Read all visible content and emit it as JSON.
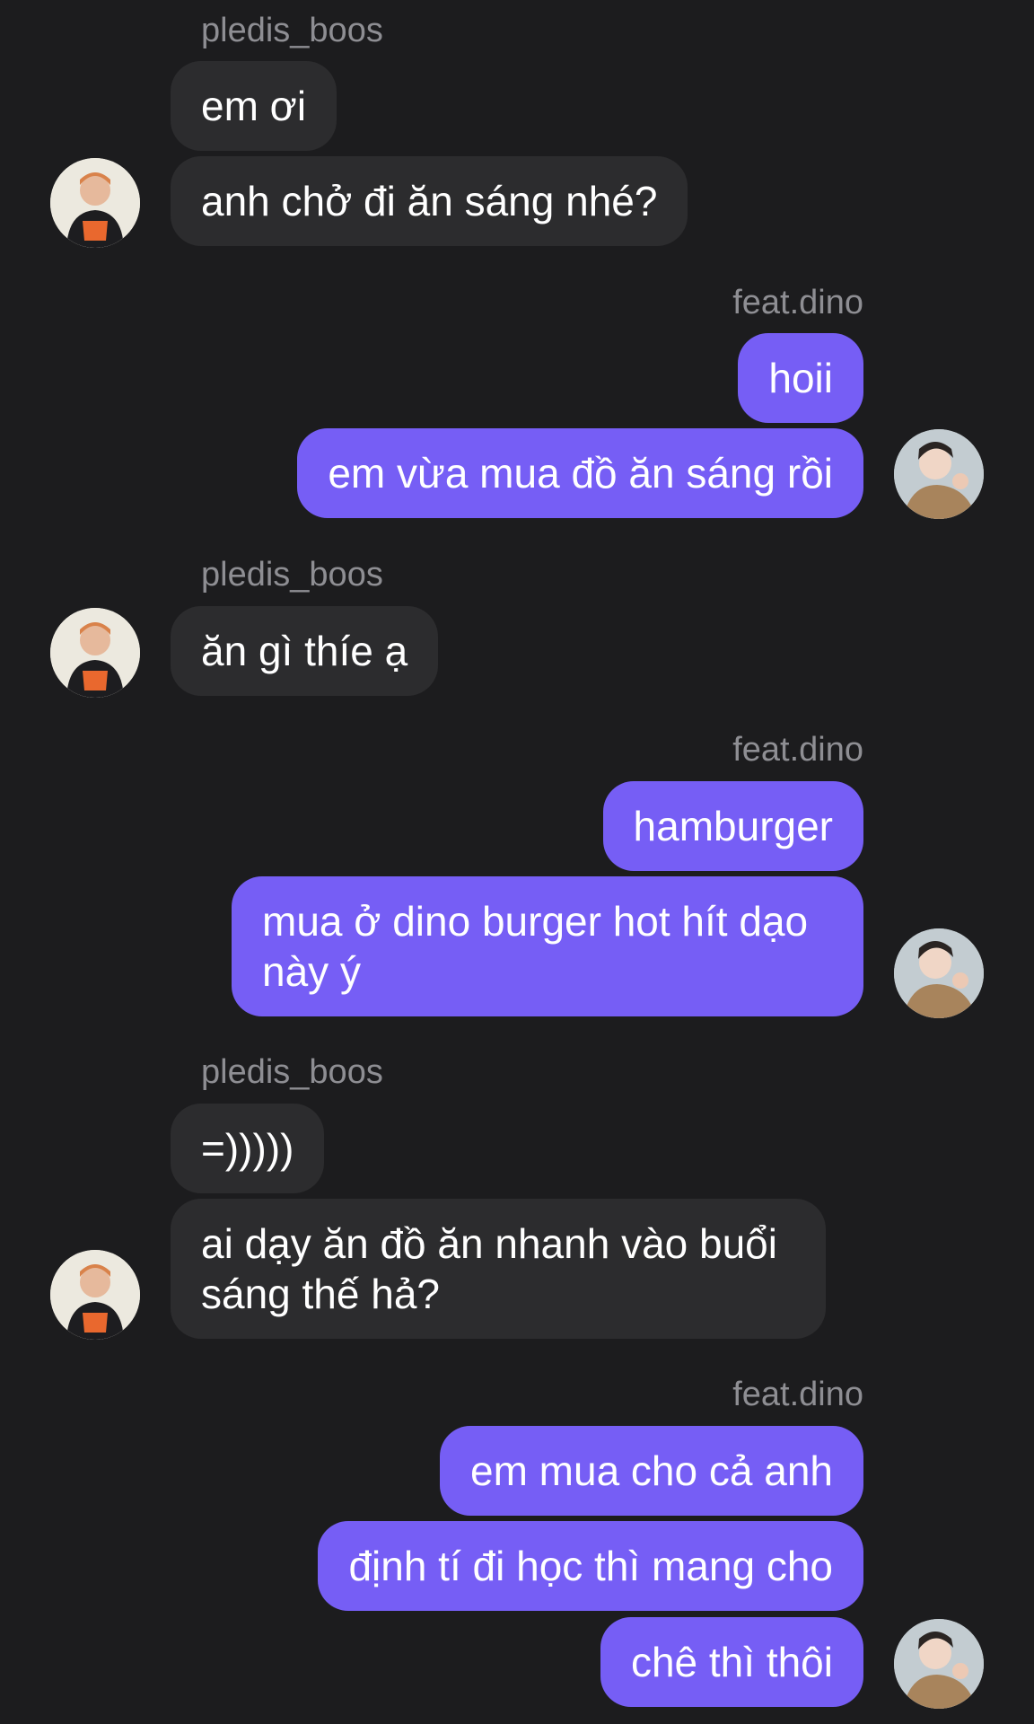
{
  "users": {
    "left": "pledis_boos",
    "right": "feat.dino"
  },
  "messages": [
    {
      "from": "pledis_boos",
      "text": "em ơi"
    },
    {
      "from": "pledis_boos",
      "text": "anh chở đi ăn sáng nhé?"
    },
    {
      "from": "feat.dino",
      "text": "hoii"
    },
    {
      "from": "feat.dino",
      "text": "em vừa mua đồ ăn sáng rồi"
    },
    {
      "from": "pledis_boos",
      "text": "ăn gì thíe ạ"
    },
    {
      "from": "feat.dino",
      "text": "hamburger"
    },
    {
      "from": "feat.dino",
      "text": "mua ở dino burger hot hít dạo này ý"
    },
    {
      "from": "pledis_boos",
      "text": "=)))))"
    },
    {
      "from": "pledis_boos",
      "text": "ai dạy ăn đồ ăn nhanh vào buổi sáng thế hả?"
    },
    {
      "from": "feat.dino",
      "text": "em mua cho cả anh"
    },
    {
      "from": "feat.dino",
      "text": "định tí đi học thì mang cho"
    },
    {
      "from": "feat.dino",
      "text": "chê thì thôi"
    }
  ],
  "colors": {
    "background": "#1c1c1e",
    "incoming_bubble": "#2c2c2e",
    "outgoing_bubble": "#765ef5",
    "sender_name": "#8e8e93"
  }
}
